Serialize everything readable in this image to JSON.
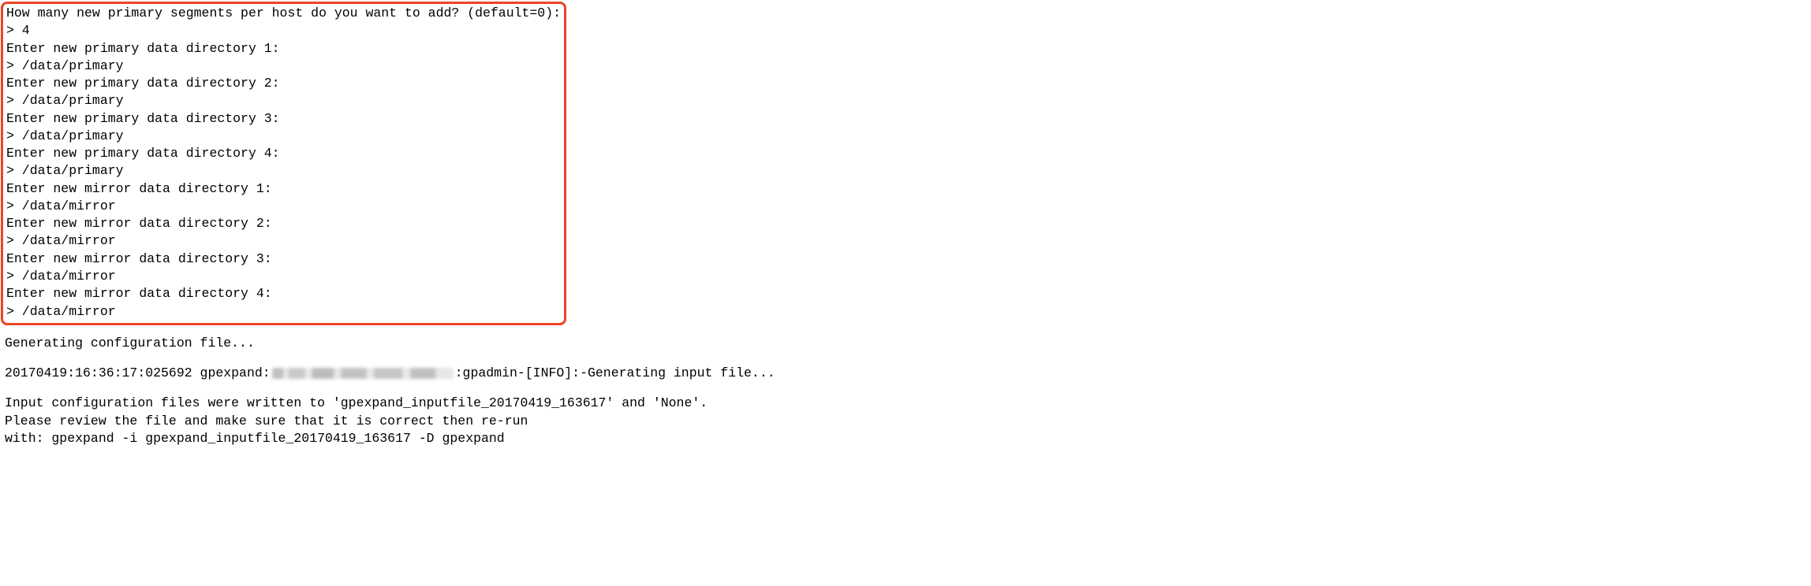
{
  "promptArea": {
    "lines": [
      "How many new primary segments per host do you want to add? (default=0):",
      "> 4",
      "Enter new primary data directory 1:",
      "> /data/primary",
      "Enter new primary data directory 2:",
      "> /data/primary",
      "Enter new primary data directory 3:",
      "> /data/primary",
      "Enter new primary data directory 4:",
      "> /data/primary",
      "Enter new mirror data directory 1:",
      "> /data/mirror",
      "Enter new mirror data directory 2:",
      "> /data/mirror",
      "Enter new mirror data directory 3:",
      "> /data/mirror",
      "Enter new mirror data directory 4:",
      "> /data/mirror"
    ]
  },
  "log": {
    "generating": "Generating configuration file...",
    "tsLinePre": "20170419:16:36:17:025692 gpexpand:",
    "tsLinePost": ":gpadmin-[INFO]:-Generating input file...",
    "result1": "Input configuration files were written to 'gpexpand_inputfile_20170419_163617' and 'None'.",
    "result2": "Please review the file and make sure that it is correct then re-run",
    "result3": "with: gpexpand -i gpexpand_inputfile_20170419_163617 -D gpexpand"
  }
}
